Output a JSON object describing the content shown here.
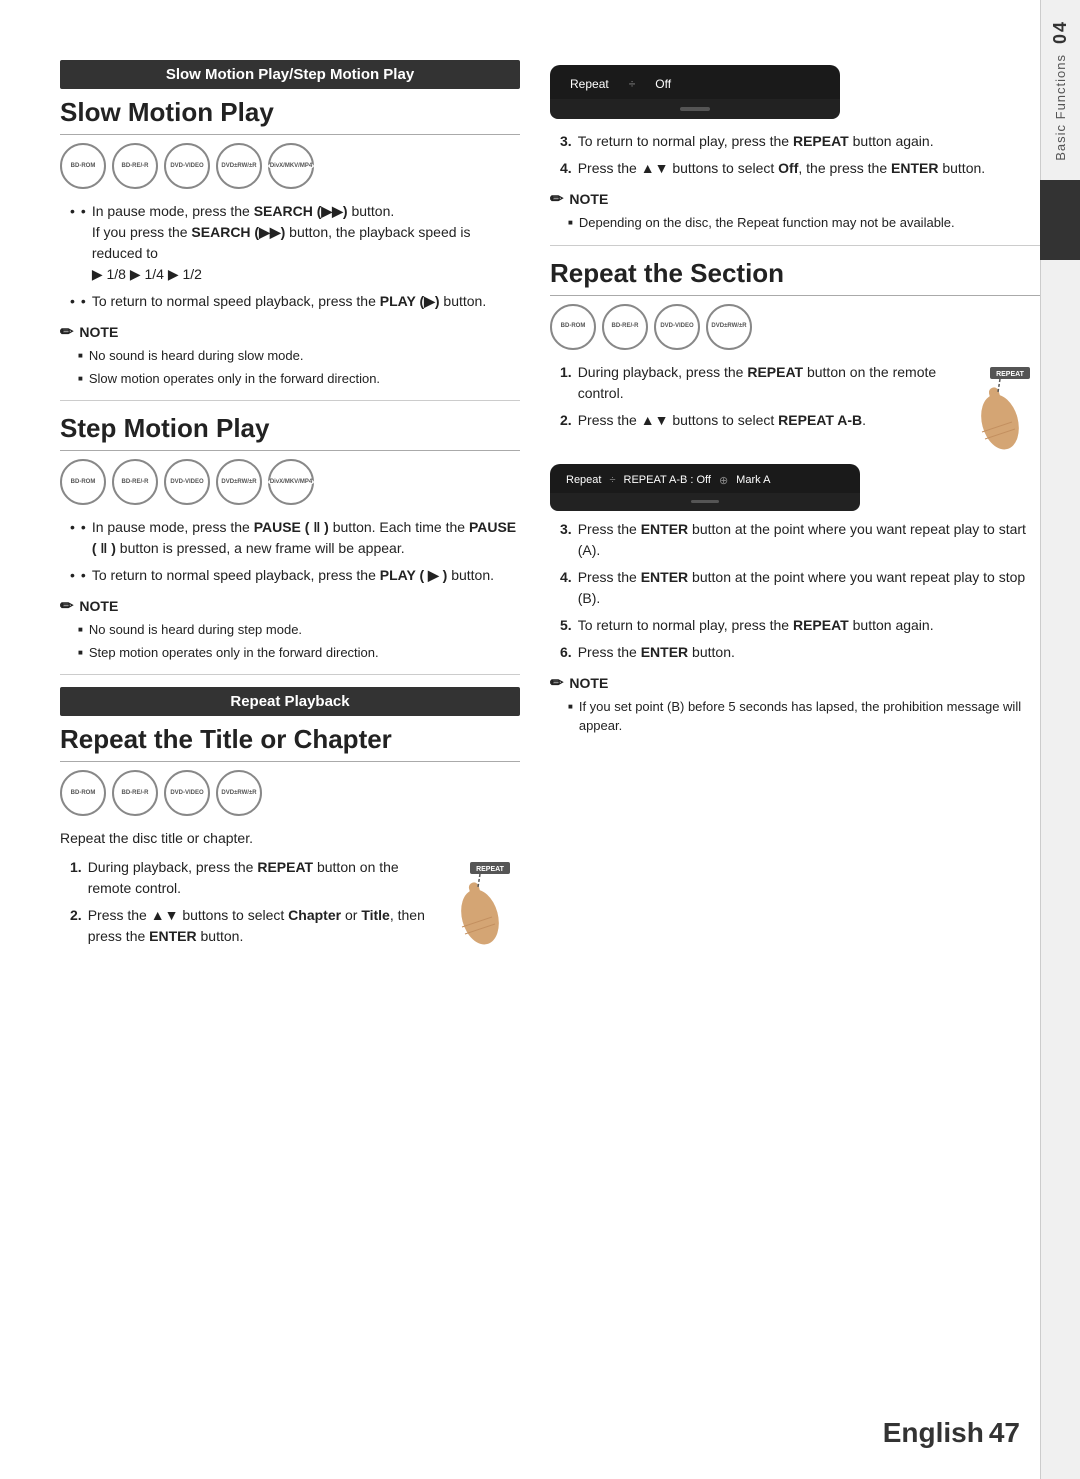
{
  "page": {
    "number": "47",
    "language": "English",
    "chapter_number": "04",
    "chapter_title": "Basic Functions"
  },
  "slow_motion_play": {
    "banner": "Slow Motion Play/Step Motion Play",
    "title": "Slow Motion Play",
    "disc_icons": [
      "BD-ROM",
      "BD-RE/-R",
      "DVD-VIDEO",
      "DVD±RW/±R",
      "DivX/MKV/MP4"
    ],
    "bullet1_prefix": "In pause mode, press the ",
    "bullet1_bold": "SEARCH (▶▶)",
    "bullet1_suffix": " button.",
    "bullet1_sub": "If you press the ",
    "bullet1_sub_bold": "SEARCH (▶▶)",
    "bullet1_sub_suffix": " button, the playback speed is reduced to",
    "bullet1_speeds": "▶ 1/8 ▶ 1/4 ▶ 1/2",
    "bullet2_prefix": "To return to normal speed playback, press the ",
    "bullet2_bold": "PLAY (▶)",
    "bullet2_suffix": " button.",
    "note_header": "NOTE",
    "note_items": [
      "No sound is heard during slow mode.",
      "Slow motion operates only in the forward direction."
    ]
  },
  "step_motion_play": {
    "title": "Step Motion Play",
    "disc_icons": [
      "BD-ROM",
      "BD-RE/-R",
      "DVD-VIDEO",
      "DVD±RW/±R",
      "DivX/MKV/MP4"
    ],
    "bullet1_prefix": "In pause mode, press the ",
    "bullet1_bold": "PAUSE ( ‖ )",
    "bullet1_suffix": " button. Each time the ",
    "bullet1_bold2": "PAUSE ( ‖ )",
    "bullet1_suffix2": " button is pressed, a new frame will be appear.",
    "bullet2_prefix": "To return to normal speed playback, press the ",
    "bullet2_bold": "PLAY ( ▶ )",
    "bullet2_suffix": " button.",
    "note_header": "NOTE",
    "note_items": [
      "No sound is heard during step mode.",
      "Step motion operates only in the forward direction."
    ]
  },
  "repeat_playback": {
    "banner": "Repeat Playback"
  },
  "repeat_title_chapter": {
    "title": "Repeat the Title or Chapter",
    "disc_icons": [
      "BD-ROM",
      "BD-RE/-R",
      "DVD-VIDEO",
      "DVD±RW/±R"
    ],
    "intro": "Repeat the disc title or chapter.",
    "steps": [
      {
        "num": "1.",
        "text_prefix": "During playback, press the ",
        "text_bold": "REPEAT",
        "text_suffix": " button on the remote control."
      },
      {
        "num": "2.",
        "text_prefix": "Press the ▲▼ buttons to select ",
        "text_bold": "Chapter",
        "text_mid": " or ",
        "text_bold2": "Title",
        "text_suffix": ", then press the ",
        "text_bold3": "ENTER",
        "text_suffix2": " button."
      }
    ]
  },
  "right_column": {
    "osd_repeat_off": {
      "label": "Repeat",
      "divider": "÷",
      "value": "Off"
    },
    "step3_prefix": "To return to normal play, press the ",
    "step3_bold": "REPEAT",
    "step3_suffix": " button again.",
    "step4_prefix": "Press the ▲▼ buttons to select ",
    "step4_bold": "Off",
    "step4_suffix": ", the press the ",
    "step4_bold2": "ENTER",
    "step4_suffix2": " button.",
    "note_header": "NOTE",
    "note_items": [
      "Depending on the disc, the Repeat function may not be available."
    ],
    "repeat_section": {
      "title": "Repeat the Section",
      "disc_icons": [
        "BD-ROM",
        "BD-RE/-R",
        "DVD-VIDEO",
        "DVD±RW/±R"
      ],
      "steps": [
        {
          "num": "1.",
          "text_prefix": "During playback, press the ",
          "text_bold": "REPEAT",
          "text_suffix": " button on the remote control."
        },
        {
          "num": "2.",
          "text_prefix": "Press the ▲▼ buttons to select ",
          "text_bold": "REPEAT A-B",
          "text_suffix": "."
        }
      ],
      "osd_ab": {
        "label": "Repeat",
        "divider": "÷",
        "value1": "REPEAT A-B : Off",
        "divider2": "⊕",
        "value2": "Mark A"
      },
      "step3_prefix": "Press the ",
      "step3_bold": "ENTER",
      "step3_suffix": " button at the point where you want repeat play to start (A).",
      "step4_prefix": "Press the ",
      "step4_bold": "ENTER",
      "step4_suffix": " button at the point where you want repeat play to stop (B).",
      "step5_prefix": "To return to normal play, press the ",
      "step5_bold": "REPEAT",
      "step5_suffix": " button again.",
      "step6_prefix": "Press the ",
      "step6_bold": "ENTER",
      "step6_suffix": " button.",
      "note_header": "NOTE",
      "note_items": [
        "If you set point (B) before 5 seconds has lapsed, the prohibition message will appear."
      ]
    }
  }
}
